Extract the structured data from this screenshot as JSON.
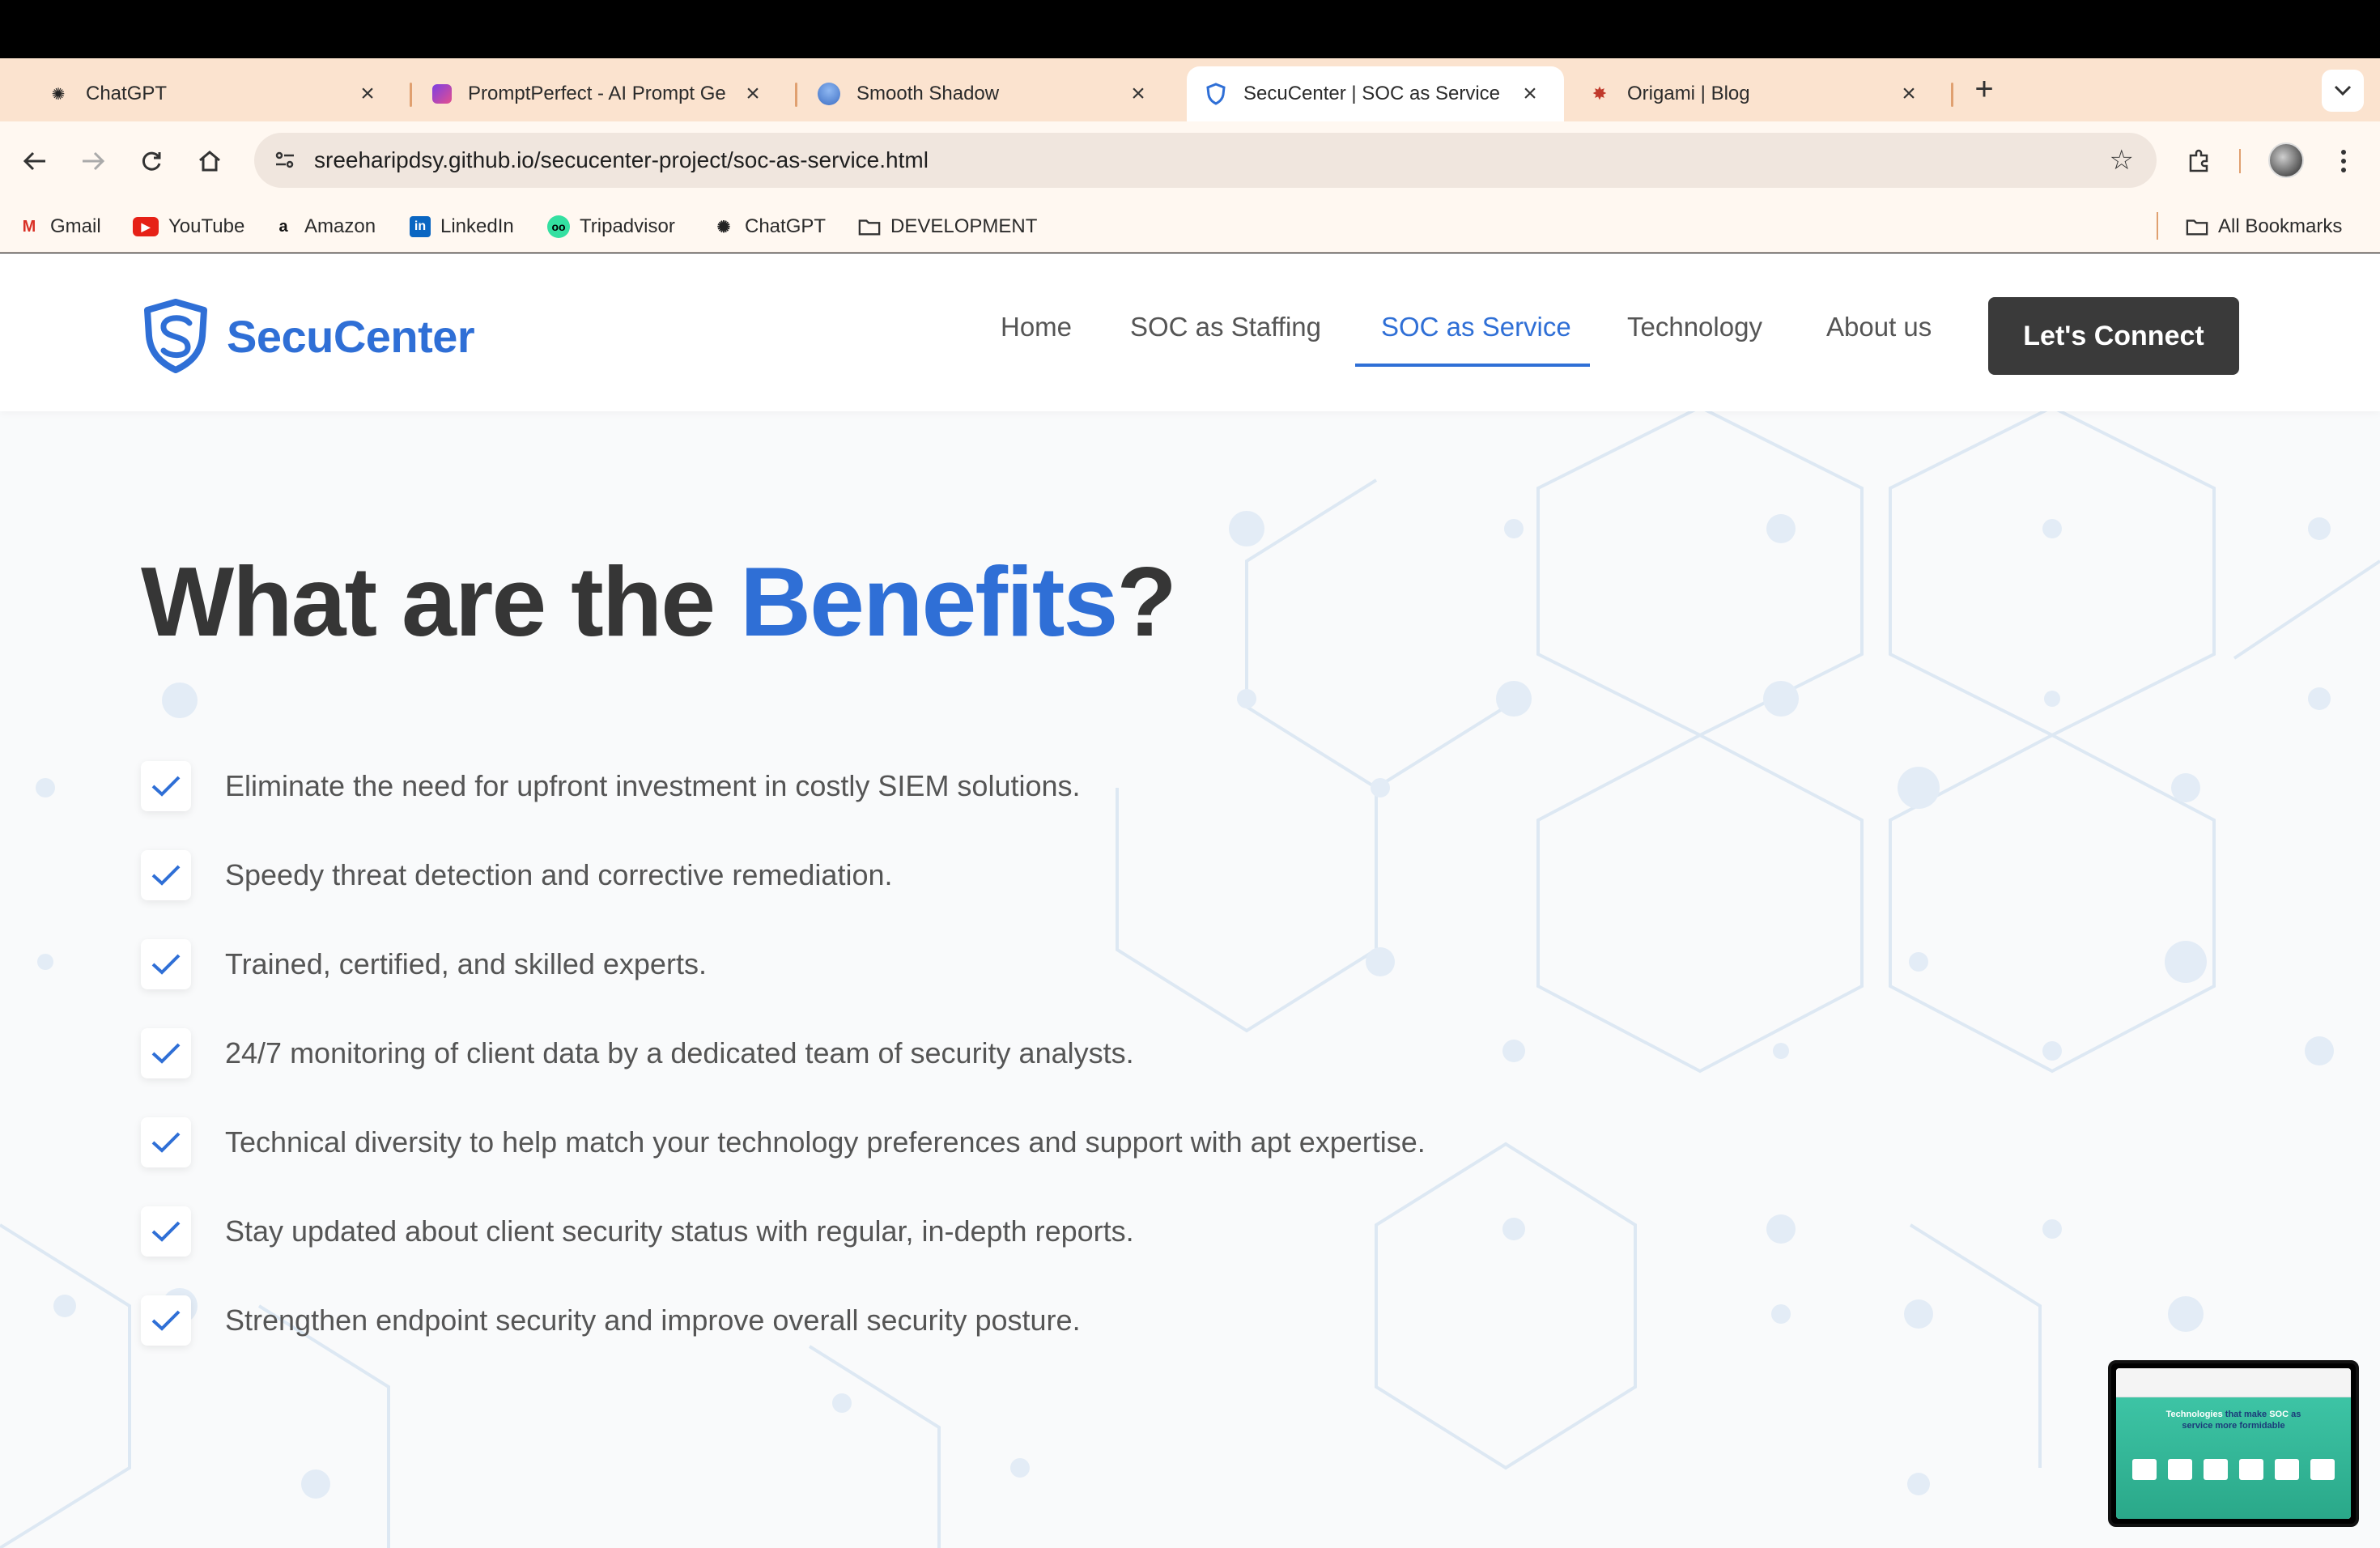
{
  "tabs": [
    {
      "title": "ChatGPT",
      "icon": "chatgpt-icon"
    },
    {
      "title": "PromptPerfect - AI Prompt Ge",
      "icon": "promptperfect-icon"
    },
    {
      "title": "Smooth Shadow",
      "icon": "smooth-shadow-icon"
    },
    {
      "title": "SecuCenter | SOC as Service",
      "icon": "secucenter-shield-icon",
      "active": true
    },
    {
      "title": "Origami | Blog",
      "icon": "origami-icon"
    }
  ],
  "address_bar": {
    "url": "sreeharipdsy.github.io/secucenter-project/soc-as-service.html"
  },
  "bookmarks": [
    {
      "label": "Gmail",
      "icon": "gmail-icon"
    },
    {
      "label": "YouTube",
      "icon": "youtube-icon"
    },
    {
      "label": "Amazon",
      "icon": "amazon-icon"
    },
    {
      "label": "LinkedIn",
      "icon": "linkedin-icon"
    },
    {
      "label": "Tripadvisor",
      "icon": "tripadvisor-icon"
    },
    {
      "label": "ChatGPT",
      "icon": "chatgpt-icon"
    },
    {
      "label": "DEVELOPMENT",
      "icon": "folder-icon"
    }
  ],
  "all_bookmarks": "All Bookmarks",
  "site": {
    "brand": "SecuCenter",
    "nav": [
      {
        "label": "Home"
      },
      {
        "label": "SOC as Staffing"
      },
      {
        "label": "SOC as Service",
        "active": true
      },
      {
        "label": "Technology"
      },
      {
        "label": "About us"
      }
    ],
    "cta": "Let's Connect",
    "headline_prefix": "What are the ",
    "headline_accent": "Benefits",
    "headline_suffix": "?",
    "benefits": [
      "Eliminate the need for upfront investment in costly SIEM solutions.",
      "Speedy threat detection and corrective remediation.",
      "Trained, certified, and skilled experts.",
      "24/7 monitoring of client data by a dedicated team of security analysts.",
      "Technical diversity to help match your technology preferences and support with apt expertise.",
      "Stay updated about client security status with regular, in-depth reports.",
      "Strengthen endpoint security and improve overall security posture."
    ]
  },
  "pip_preview": {
    "text_a": "Technologies ",
    "text_b": "that make ",
    "text_c": "SOC ",
    "text_d": "as",
    "text_e": "service more formidable"
  },
  "colors": {
    "accent": "#2f6fd6",
    "dark": "#363636",
    "tabstrip": "#fbe3cf",
    "cta_bg": "#3a3a3a"
  }
}
